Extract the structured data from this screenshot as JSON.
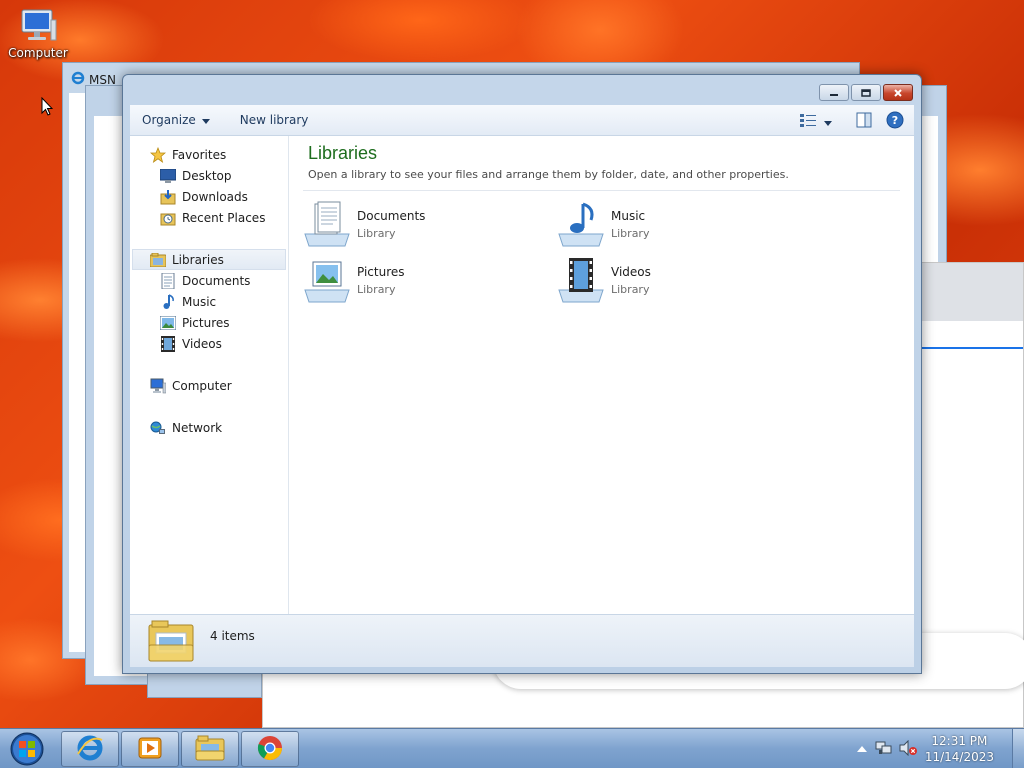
{
  "desktop": {
    "icons": [
      {
        "label": "Computer",
        "icon": "computer-icon"
      }
    ]
  },
  "background_windows": {
    "ie_title": "MSN"
  },
  "explorer": {
    "toolbar": {
      "organize_label": "Organize",
      "new_library_label": "New library"
    },
    "nav": {
      "favorites": {
        "label": "Favorites",
        "items": [
          "Desktop",
          "Downloads",
          "Recent Places"
        ]
      },
      "libraries": {
        "label": "Libraries",
        "items": [
          "Documents",
          "Music",
          "Pictures",
          "Videos"
        ]
      },
      "computer_label": "Computer",
      "network_label": "Network"
    },
    "content": {
      "title": "Libraries",
      "subtitle": "Open a library to see your files and arrange them by folder, date, and other properties.",
      "items": [
        {
          "name": "Documents",
          "type": "Library",
          "icon": "documents-library-icon"
        },
        {
          "name": "Music",
          "type": "Library",
          "icon": "music-library-icon"
        },
        {
          "name": "Pictures",
          "type": "Library",
          "icon": "pictures-library-icon"
        },
        {
          "name": "Videos",
          "type": "Library",
          "icon": "videos-library-icon"
        }
      ]
    },
    "details": {
      "count": "4 items"
    }
  },
  "taskbar": {
    "pinned": [
      "internet-explorer-icon",
      "media-player-icon",
      "explorer-folder-icon",
      "chrome-icon"
    ],
    "clock": {
      "time": "12:31 PM",
      "date": "11/14/2023"
    }
  },
  "colors": {
    "accent_title": "#1e6d1e",
    "window_frame": "#c4d6ea",
    "taskbar": "#7fa3cf"
  }
}
